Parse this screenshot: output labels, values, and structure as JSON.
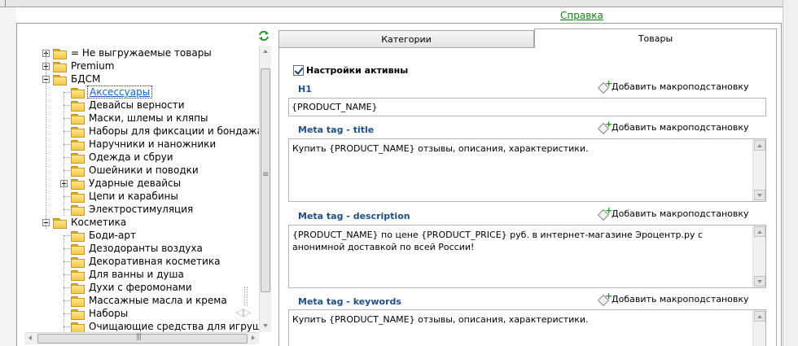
{
  "header": {
    "help_link": "Справка"
  },
  "tree": {
    "items": [
      {
        "label": "= Не выгружаемые товары",
        "level": 0,
        "expander": "plus"
      },
      {
        "label": "Premium",
        "level": 0,
        "expander": "plus"
      },
      {
        "label": "БДСМ",
        "level": 0,
        "expander": "minus"
      },
      {
        "label": "Аксессуары",
        "level": 1,
        "expander": "none",
        "selected": true
      },
      {
        "label": "Девайсы верности",
        "level": 1,
        "expander": "none"
      },
      {
        "label": "Маски, шлемы и кляпы",
        "level": 1,
        "expander": "none"
      },
      {
        "label": "Наборы для фиксации и бондажа",
        "level": 1,
        "expander": "none"
      },
      {
        "label": "Наручники и наножники",
        "level": 1,
        "expander": "none"
      },
      {
        "label": "Одежда и сбруи",
        "level": 1,
        "expander": "none"
      },
      {
        "label": "Ошейники и поводки",
        "level": 1,
        "expander": "none"
      },
      {
        "label": "Ударные девайсы",
        "level": 1,
        "expander": "plus"
      },
      {
        "label": "Цепи и карабины",
        "level": 1,
        "expander": "none"
      },
      {
        "label": "Электростимуляция",
        "level": 1,
        "expander": "none"
      },
      {
        "label": "Косметика",
        "level": 0,
        "expander": "minus"
      },
      {
        "label": "Боди-арт",
        "level": 1,
        "expander": "none"
      },
      {
        "label": "Дезодоранты воздуха",
        "level": 1,
        "expander": "none"
      },
      {
        "label": "Декоративная косметика",
        "level": 1,
        "expander": "none"
      },
      {
        "label": "Для ванны и душа",
        "level": 1,
        "expander": "none"
      },
      {
        "label": "Духи с феромонами",
        "level": 1,
        "expander": "none"
      },
      {
        "label": "Массажные масла и крема",
        "level": 1,
        "expander": "none"
      },
      {
        "label": "Наборы",
        "level": 1,
        "expander": "none"
      },
      {
        "label": "Очищающие средства для игрушек и",
        "level": 1,
        "expander": "none"
      }
    ]
  },
  "tabs": {
    "categories": "Категории",
    "products": "Товары",
    "active": "products"
  },
  "settings": {
    "active_checkbox_label": "Настройки активны",
    "active_checked": true,
    "macro_link": "Добавить макроподстановку",
    "h1": {
      "label": "H1",
      "value": "{PRODUCT_NAME}"
    },
    "meta_title": {
      "label": "Meta tag - title",
      "value": "Купить {PRODUCT_NAME} отзывы, описания, характеристики."
    },
    "meta_description": {
      "label": "Meta tag - description",
      "value": "{PRODUCT_NAME} по цене {PRODUCT_PRICE} руб. в интернет-магазине Эроцентр.ру с анонимной доставкой по всей России!"
    },
    "meta_keywords": {
      "label": "Meta tag - keywords",
      "value": "Купить {PRODUCT_NAME} отзывы, описания, характеристики."
    }
  },
  "colors": {
    "label_blue": "#1f4f8a",
    "link_green": "#0a8a0a",
    "folder_yellow": "#f5c94a"
  }
}
